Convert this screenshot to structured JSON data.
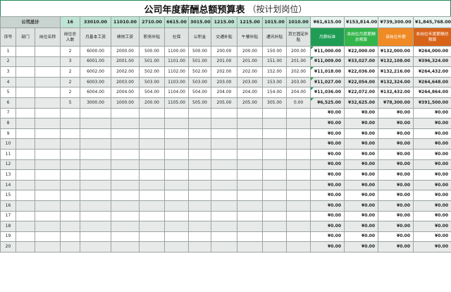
{
  "title": {
    "main": "公司年度薪酬总额预算表",
    "sub": "（按计划岗位）"
  },
  "totals": {
    "label": "公司总计",
    "headcount": "16",
    "base": "33010.00",
    "perf": "11010.00",
    "allow": "2710.00",
    "social": "6615.00",
    "fund": "3015.00",
    "traffic": "1215.00",
    "lunch": "1215.00",
    "comm": "1015.00",
    "other": "1010.00",
    "monthly": "¥61,615.00",
    "yearly": "¥153,814.00",
    "bonus": "¥739,300.00",
    "annual": "¥1,845,768.00"
  },
  "headers": [
    "序号",
    "部门",
    "岗位名称",
    "岗位总人数",
    "月基本工资",
    "绩效工资",
    "职务补贴",
    "社保",
    "公积金",
    "交通补贴",
    "午餐补贴",
    "通讯补贴",
    "其它固定补贴",
    "月薪标准",
    "本岗位月度薪酬总预算",
    "该岗位年薪",
    "本岗位年度薪酬总预算"
  ],
  "rows": [
    {
      "no": "1",
      "dept": "",
      "pos": "",
      "count": "2",
      "base": "6000.00",
      "perf": "2000.00",
      "allow": "500.00",
      "social": "1100.00",
      "fund": "500.00",
      "traffic": "200.00",
      "lunch": "200.00",
      "comm": "150.00",
      "other": "200.00",
      "monthly": "¥11,000.00",
      "month_total": "¥22,000.00",
      "year": "¥132,000.00",
      "year_total": "¥264,000.00"
    },
    {
      "no": "2",
      "dept": "",
      "pos": "",
      "count": "3",
      "base": "6001.00",
      "perf": "2001.00",
      "allow": "501.00",
      "social": "1101.00",
      "fund": "501.00",
      "traffic": "201.00",
      "lunch": "201.00",
      "comm": "151.00",
      "other": "201.00",
      "monthly": "¥11,009.00",
      "month_total": "¥33,027.00",
      "year": "¥132,108.00",
      "year_total": "¥396,324.00"
    },
    {
      "no": "3",
      "dept": "",
      "pos": "",
      "count": "2",
      "base": "6002.00",
      "perf": "2002.00",
      "allow": "502.00",
      "social": "1102.00",
      "fund": "502.00",
      "traffic": "202.00",
      "lunch": "202.00",
      "comm": "152.00",
      "other": "202.00",
      "monthly": "¥11,018.00",
      "month_total": "¥22,036.00",
      "year": "¥132,216.00",
      "year_total": "¥264,432.00"
    },
    {
      "no": "4",
      "dept": "",
      "pos": "",
      "count": "2",
      "base": "6003.00",
      "perf": "2003.00",
      "allow": "503.00",
      "social": "1103.00",
      "fund": "503.00",
      "traffic": "203.00",
      "lunch": "203.00",
      "comm": "153.00",
      "other": "203.00",
      "monthly": "¥11,027.00",
      "month_total": "¥22,054.00",
      "year": "¥132,324.00",
      "year_total": "¥264,648.00"
    },
    {
      "no": "5",
      "dept": "",
      "pos": "",
      "count": "2",
      "base": "6004.00",
      "perf": "2004.00",
      "allow": "504.00",
      "social": "1104.00",
      "fund": "504.00",
      "traffic": "204.00",
      "lunch": "204.00",
      "comm": "154.00",
      "other": "204.00",
      "monthly": "¥11,036.00",
      "month_total": "¥22,072.00",
      "year": "¥132,432.00",
      "year_total": "¥264,864.00"
    },
    {
      "no": "6",
      "dept": "",
      "pos": "",
      "count": "5",
      "base": "3000.00",
      "perf": "1000.00",
      "allow": "200.00",
      "social": "1105.00",
      "fund": "505.00",
      "traffic": "205.00",
      "lunch": "205.00",
      "comm": "305.00",
      "other": "0.00",
      "monthly": "¥6,525.00",
      "month_total": "¥32,625.00",
      "year": "¥78,300.00",
      "year_total": "¥391,500.00"
    },
    {
      "no": "7",
      "monthly": "¥0.00",
      "month_total": "¥0.00",
      "year": "¥0.00",
      "year_total": "¥0.00"
    },
    {
      "no": "8",
      "monthly": "¥0.00",
      "month_total": "¥0.00",
      "year": "¥0.00",
      "year_total": "¥0.00"
    },
    {
      "no": "9",
      "monthly": "¥0.00",
      "month_total": "¥0.00",
      "year": "¥0.00",
      "year_total": "¥0.00"
    },
    {
      "no": "10",
      "monthly": "¥0.00",
      "month_total": "¥0.00",
      "year": "¥0.00",
      "year_total": "¥0.00"
    },
    {
      "no": "11",
      "monthly": "¥0.00",
      "month_total": "¥0.00",
      "year": "¥0.00",
      "year_total": "¥0.00"
    },
    {
      "no": "12",
      "monthly": "¥0.00",
      "month_total": "¥0.00",
      "year": "¥0.00",
      "year_total": "¥0.00"
    },
    {
      "no": "13",
      "monthly": "¥0.00",
      "month_total": "¥0.00",
      "year": "¥0.00",
      "year_total": "¥0.00"
    },
    {
      "no": "14",
      "monthly": "¥0.00",
      "month_total": "¥0.00",
      "year": "¥0.00",
      "year_total": "¥0.00"
    },
    {
      "no": "15",
      "monthly": "¥0.00",
      "month_total": "¥0.00",
      "year": "¥0.00",
      "year_total": "¥0.00"
    },
    {
      "no": "16",
      "monthly": "¥0.00",
      "month_total": "¥0.00",
      "year": "¥0.00",
      "year_total": "¥0.00"
    },
    {
      "no": "17",
      "monthly": "¥0.00",
      "month_total": "¥0.00",
      "year": "¥0.00",
      "year_total": "¥0.00"
    },
    {
      "no": "18",
      "monthly": "¥0.00",
      "month_total": "¥0.00",
      "year": "¥0.00",
      "year_total": "¥0.00"
    },
    {
      "no": "19",
      "monthly": "¥0.00",
      "month_total": "¥0.00",
      "year": "¥0.00",
      "year_total": "¥0.00"
    },
    {
      "no": "20",
      "monthly": "¥0.00",
      "month_total": "¥0.00",
      "year": "¥0.00",
      "year_total": "¥0.00"
    }
  ],
  "colors": {
    "green": "#1f9d55",
    "lime": "#33b54a",
    "orange": "#f08a24",
    "dark_orange": "#d8641a"
  }
}
